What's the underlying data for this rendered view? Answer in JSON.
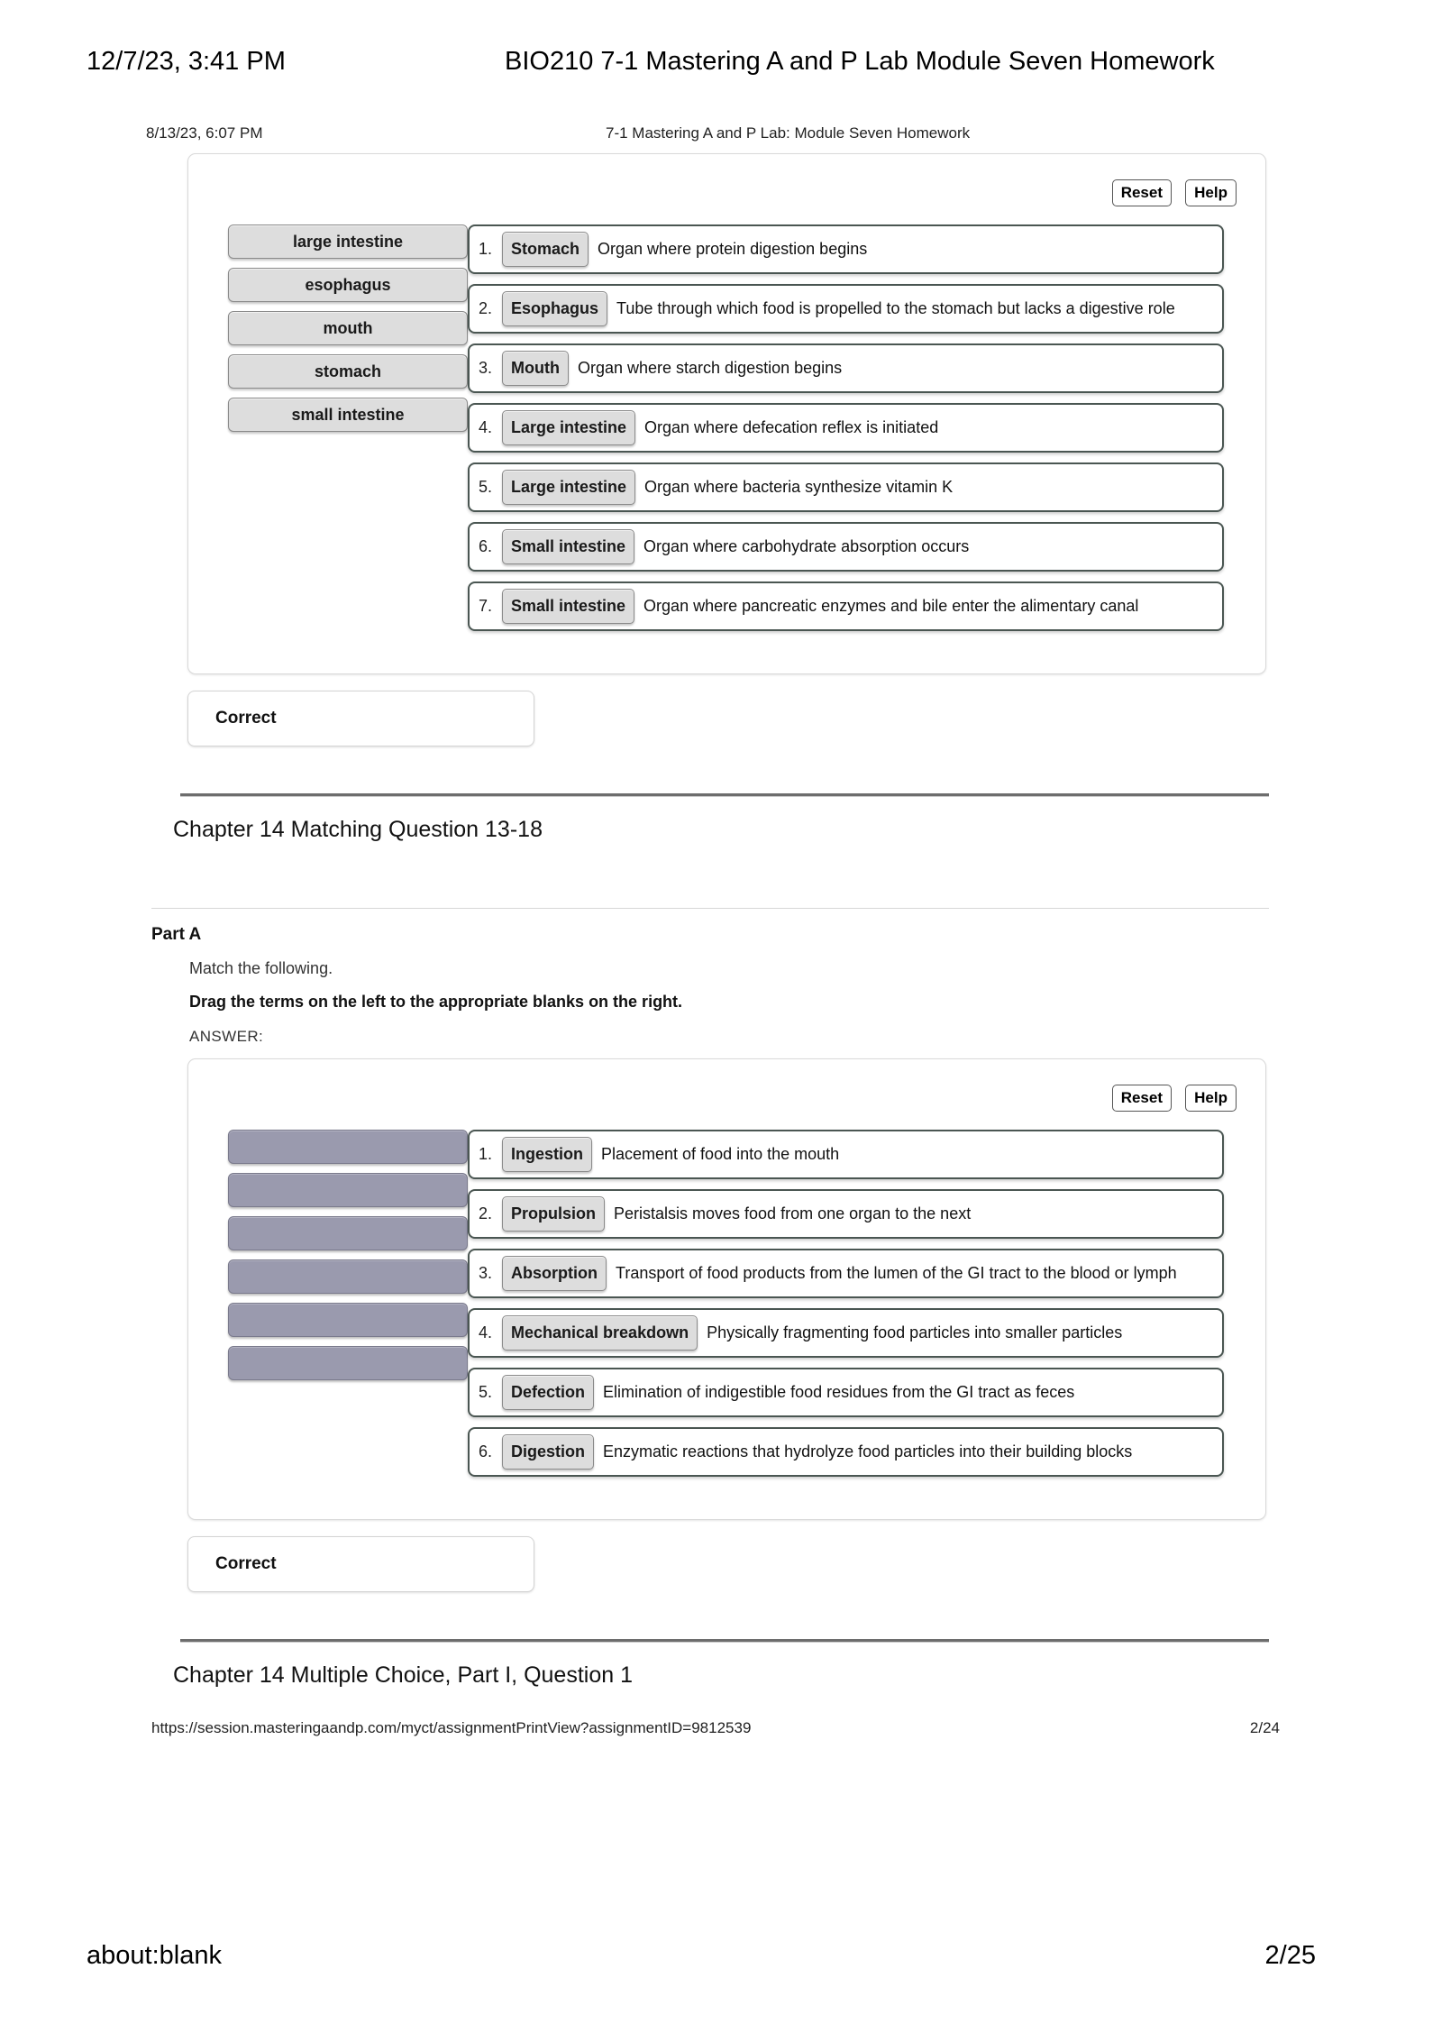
{
  "browser": {
    "header_date": "12/7/23, 3:41 PM",
    "header_title": "BIO210 7-1 Mastering A and P Lab Module Seven Homework",
    "footer_url": "about:blank",
    "footer_page": "2/25"
  },
  "document": {
    "header_date": "8/13/23, 6:07 PM",
    "header_title": "7-1 Mastering A and P Lab: Module Seven Homework",
    "footer_url": "https://session.masteringaandp.com/myct/assignmentPrintView?assignmentID=9812539",
    "footer_page": "2/24"
  },
  "toolbar": {
    "reset_label": "Reset",
    "help_label": "Help"
  },
  "exercise_one": {
    "term_bank": [
      {
        "label": "large intestine",
        "used": false
      },
      {
        "label": "esophagus",
        "used": false
      },
      {
        "label": "mouth",
        "used": false
      },
      {
        "label": "stomach",
        "used": false
      },
      {
        "label": "small intestine",
        "used": false
      }
    ],
    "slots": [
      {
        "num": "1.",
        "answer": "Stomach",
        "description": "Organ where protein digestion begins"
      },
      {
        "num": "2.",
        "answer": "Esophagus",
        "description": "Tube through which food is propelled to the stomach but lacks a digestive role"
      },
      {
        "num": "3.",
        "answer": "Mouth",
        "description": "Organ where starch digestion begins"
      },
      {
        "num": "4.",
        "answer": "Large intestine",
        "description": "Organ where defecation reflex is initiated"
      },
      {
        "num": "5.",
        "answer": "Large intestine",
        "description": "Organ where bacteria synthesize vitamin K"
      },
      {
        "num": "6.",
        "answer": "Small intestine",
        "description": "Organ where carbohydrate absorption occurs"
      },
      {
        "num": "7.",
        "answer": "Small intestine",
        "description": "Organ where pancreatic enzymes and bile enter the alimentary canal"
      }
    ],
    "feedback": "Correct"
  },
  "chapter_heading_one": "Chapter 14 Matching Question 13-18",
  "part_a": {
    "label": "Part A",
    "instruction": "Match the following.",
    "instruction_bold": "Drag the terms on the left to the appropriate blanks on the right.",
    "answer_label": "ANSWER:"
  },
  "exercise_two": {
    "term_bank": [
      {
        "label": "",
        "used": true
      },
      {
        "label": "",
        "used": true
      },
      {
        "label": "",
        "used": true
      },
      {
        "label": "",
        "used": true
      },
      {
        "label": "",
        "used": true
      },
      {
        "label": "",
        "used": true
      }
    ],
    "slots": [
      {
        "num": "1.",
        "answer": "Ingestion",
        "description": "Placement of food into the mouth"
      },
      {
        "num": "2.",
        "answer": "Propulsion",
        "description": "Peristalsis moves food from one organ to the next"
      },
      {
        "num": "3.",
        "answer": "Absorption",
        "description": "Transport of food products from the lumen of the GI tract to the blood or lymph"
      },
      {
        "num": "4.",
        "answer": "Mechanical breakdown",
        "description": "Physically fragmenting food particles into smaller particles"
      },
      {
        "num": "5.",
        "answer": "Defection",
        "description": "Elimination of indigestible food residues from the GI tract as feces"
      },
      {
        "num": "6.",
        "answer": "Digestion",
        "description": "Enzymatic reactions that hydrolyze food particles into their building blocks"
      }
    ],
    "feedback": "Correct"
  },
  "chapter_heading_two": "Chapter 14 Multiple Choice, Part I, Question 1",
  "colors": {
    "chip_fill": "#dddddd",
    "chip_used_fill": "#9a9aae",
    "slot_border": "#4a5652",
    "separator": "#6d6d6d"
  }
}
